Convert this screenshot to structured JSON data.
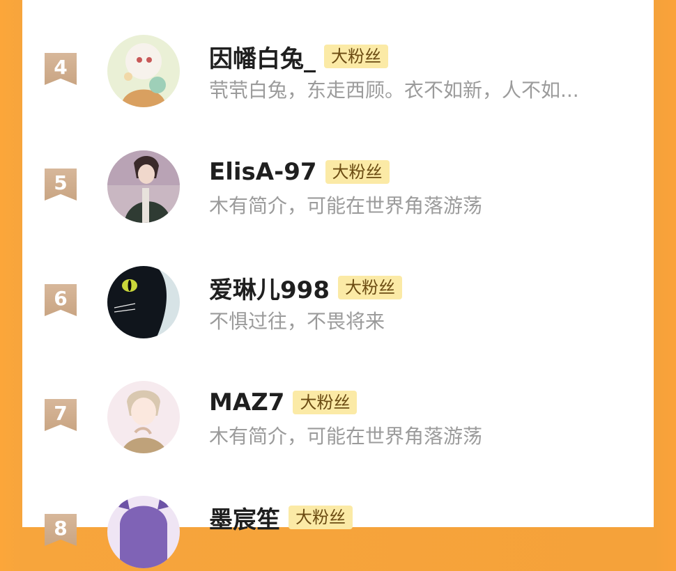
{
  "ranking": {
    "rows": [
      {
        "rank": "4",
        "name": "因幡白兔_",
        "badge": "大粉丝",
        "bio": "茕茕白兔，东走西顾。衣不如新，人不如..."
      },
      {
        "rank": "5",
        "name": "ElisA-97",
        "badge": "大粉丝",
        "bio": "木有简介，可能在世界角落游荡"
      },
      {
        "rank": "6",
        "name": "爱琳儿998",
        "badge": "大粉丝",
        "bio": "不惧过往，不畏将来"
      },
      {
        "rank": "7",
        "name": "MAZ7",
        "badge": "大粉丝",
        "bio": "木有简介，可能在世界角落游荡"
      },
      {
        "rank": "8",
        "name": "墨宸笙",
        "badge": "大粉丝",
        "bio": ""
      }
    ]
  },
  "colors": {
    "background": "#f6a53b",
    "card": "#ffffff",
    "rank_badge": "#c9a583",
    "fan_badge": "#fbeaa6",
    "bio_text": "#9b9b9b"
  },
  "avatars": [
    "anime-girl-avatar",
    "anime-boy-avatar",
    "black-cat-avatar",
    "anime-man-avatar",
    "purple-hair-avatar"
  ]
}
